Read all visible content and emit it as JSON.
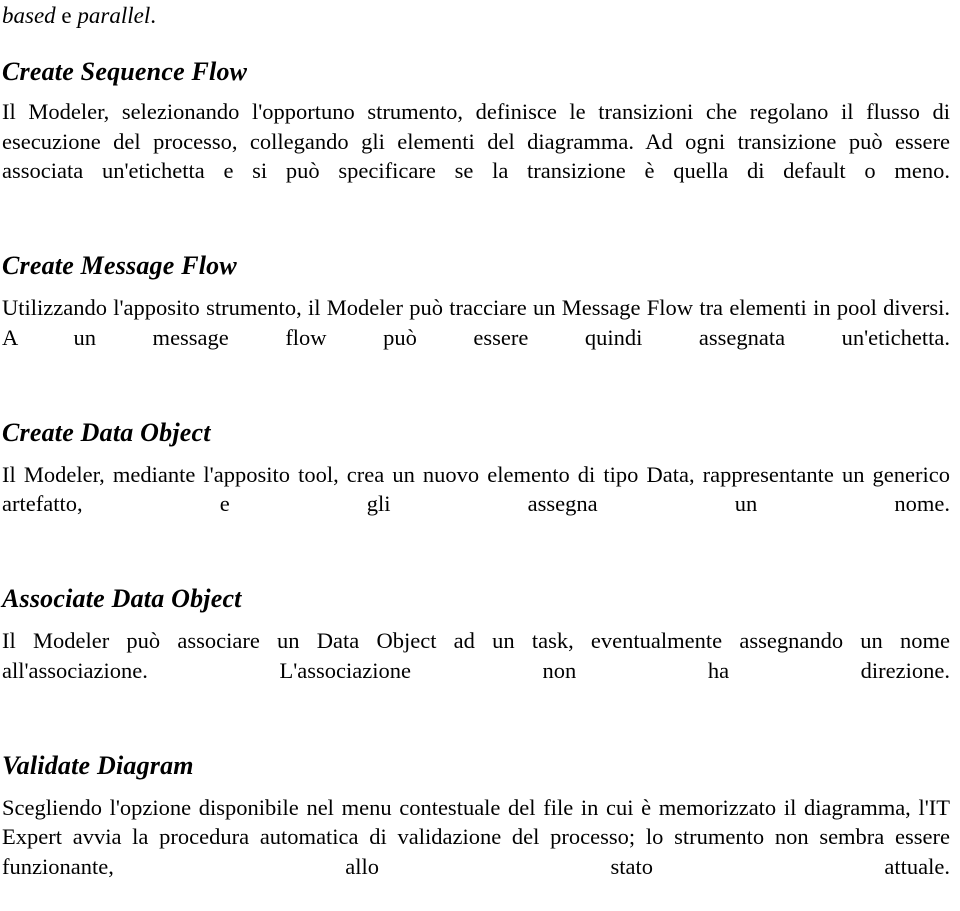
{
  "document": {
    "language": "it",
    "background_color": "#ffffff",
    "text_color": "#000000",
    "continuation_line": {
      "italic_1": "based",
      "roman_1": " e ",
      "italic_2": "parallel",
      "roman_2": "."
    },
    "sections": [
      {
        "id": "create-sequence-flow",
        "heading": "Create Sequence Flow",
        "body": "Il Modeler, selezionando l'opportuno strumento, definisce le transizioni che regolano il flusso di esecuzione del processo, collegando gli elementi del diagramma. Ad ogni transizione può essere associata un'etichetta e si può specificare se la transizione è quella di default o meno."
      },
      {
        "id": "create-message-flow",
        "heading": "Create Message Flow",
        "body": "Utilizzando l'apposito strumento, il Modeler può tracciare un Message Flow tra elementi in pool diversi. A un message flow può essere quindi assegnata un'etichetta."
      },
      {
        "id": "create-data-object",
        "heading": "Create Data Object",
        "body": "Il Modeler, mediante l'apposito tool, crea un nuovo elemento di tipo Data, rappresentante un generico artefatto, e gli assegna un nome."
      },
      {
        "id": "associate-data-object",
        "heading": "Associate Data Object",
        "body": "Il Modeler può associare un Data Object ad un task, eventualmente assegnando un nome all'associazione. L'associazione non ha direzione."
      },
      {
        "id": "validate-diagram",
        "heading": "Validate Diagram",
        "body": "Scegliendo l'opzione disponibile nel menu contestuale del file in cui è memorizzato il diagramma, l'IT Expert avvia la procedura automatica di validazione del processo; lo strumento non sembra essere funzionante, allo stato attuale."
      }
    ]
  }
}
